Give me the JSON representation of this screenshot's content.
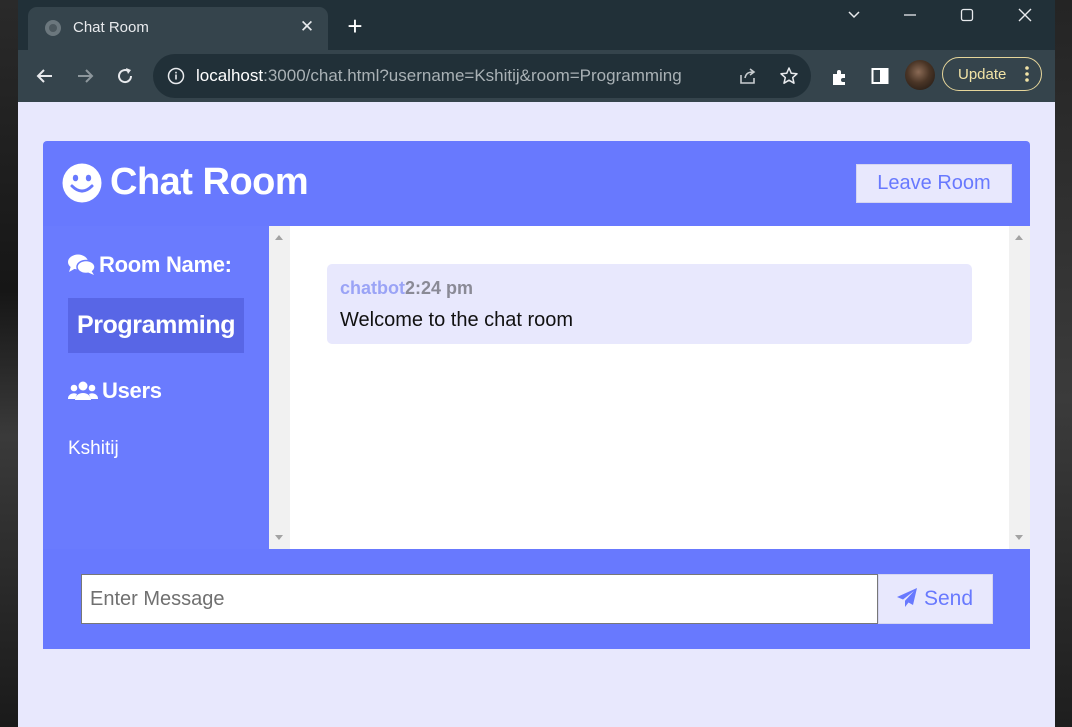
{
  "browser": {
    "tab": {
      "title": "Chat Room",
      "close_glyph": "✕"
    },
    "new_tab_glyph": "+",
    "window_controls": [
      "chevron-down-icon",
      "minimize-icon",
      "maximize-icon",
      "close-icon"
    ],
    "toolbar_icons": [
      "back-arrow-icon",
      "forward-arrow-icon",
      "reload-icon",
      "share-icon",
      "star-icon",
      "extensions-icon",
      "side-panel-icon"
    ],
    "url": {
      "host": "localhost",
      "rest": ":3000/chat.html?username=Kshitij&room=Programming"
    },
    "update_label": "Update"
  },
  "colors": {
    "accent": "#6879fe",
    "sidebar": "#6a7bfe",
    "room_badge": "#5866e6",
    "page_bg": "#e8e8fd",
    "toolbar_bg": "#35444c",
    "tabstrip_bg": "#213038"
  },
  "chat": {
    "title": "Chat Room",
    "leave_label": "Leave Room",
    "sidebar": {
      "room_heading": "Room Name:",
      "room_name": "Programming",
      "users_heading": "Users",
      "users": [
        "Kshitij"
      ]
    },
    "messages": [
      {
        "user": "chatbot",
        "time": "2:24 pm",
        "text": "Welcome to the chat room"
      }
    ],
    "input": {
      "placeholder": "Enter Message",
      "value": ""
    },
    "send_label": "Send"
  }
}
